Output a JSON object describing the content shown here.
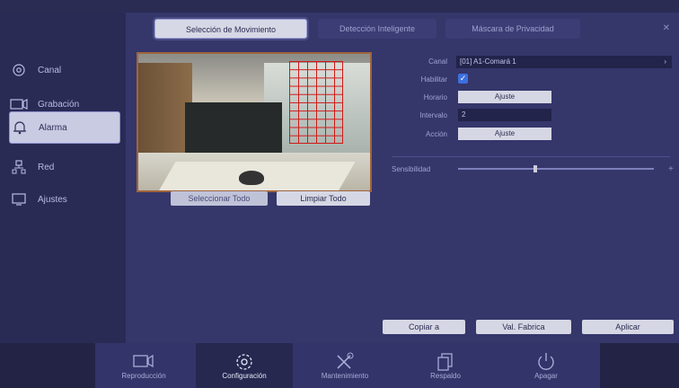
{
  "tabs": [
    {
      "label": "Selección de Movimiento"
    },
    {
      "label": "Detección Inteligente"
    },
    {
      "label": "Máscara de Privacidad"
    }
  ],
  "sidebar": {
    "items": [
      {
        "label": "Canal",
        "icon": "camera-icon"
      },
      {
        "label": "Grabación",
        "icon": "record-icon"
      },
      {
        "label": "Alarma",
        "icon": "alarm-bell-icon"
      },
      {
        "label": "Red",
        "icon": "network-icon"
      },
      {
        "label": "Ajustes",
        "icon": "monitor-icon"
      }
    ]
  },
  "preview": {
    "select_all_label": "Seleccionar Todo",
    "clear_all_label": "Limpiar Todo"
  },
  "form": {
    "channel_label": "Canal",
    "channel_value": "[01] A1-Comará 1",
    "enable_label": "Habilitar",
    "schedule_label": "Horario",
    "schedule_value": "Ajuste",
    "interval_label": "Intervalo",
    "interval_value": "2",
    "action_label": "Acción",
    "action_value": "Ajuste",
    "sensitivity_label": "Sensibilidad"
  },
  "actions": {
    "copy_label": "Copiar a",
    "default_label": "Val. Fabrica",
    "apply_label": "Aplicar"
  },
  "bottombar": {
    "items": [
      {
        "label": "Reproducción",
        "icon": "playback-icon"
      },
      {
        "label": "Configuración",
        "icon": "settings-gear-icon"
      },
      {
        "label": "Mantenimiento",
        "icon": "maintenance-tools-icon"
      },
      {
        "label": "Respaldo",
        "icon": "backup-icon"
      },
      {
        "label": "Apagar",
        "icon": "power-icon"
      }
    ]
  },
  "colors": {
    "accent": "#3d6fe0",
    "motion_grid": "#d01818"
  }
}
